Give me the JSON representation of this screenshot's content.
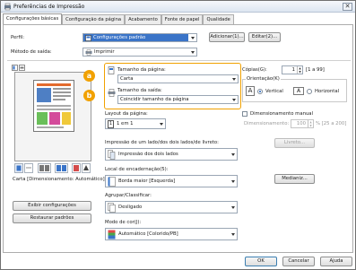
{
  "window": {
    "title": "Preferências de Impressão",
    "close_glyph": "✕"
  },
  "tabs": [
    {
      "label": "Configurações básicas"
    },
    {
      "label": "Configuração da página"
    },
    {
      "label": "Acabamento"
    },
    {
      "label": "Fonte de papel"
    },
    {
      "label": "Qualidade"
    }
  ],
  "profile": {
    "label": "Perfil:",
    "value": "Configurações padrão",
    "add_button": "Adicionar(1)...",
    "edit_button": "Editar(2)..."
  },
  "output_method": {
    "label": "Método de saída:",
    "value": "Imprimir"
  },
  "preview_caption": "Carta [Dimensionamento: Automático]",
  "callouts": {
    "a": "a",
    "b": "b"
  },
  "page_size": {
    "label": "Tamanho da página:",
    "value": "Carta"
  },
  "output_size": {
    "label": "Tamanho da saída:",
    "value": "Coincidir tamanho da página"
  },
  "copies": {
    "label": "Cópias(G):",
    "value": "1",
    "range": "[1 a 99]"
  },
  "orientation": {
    "label": "Orientação(K)",
    "portrait": "Vertical",
    "landscape": "Horizontal",
    "portrait_icon_glyph": "A",
    "landscape_icon_glyph": "A"
  },
  "layout": {
    "label": "Layout da página:",
    "value": "1 em 1",
    "icon_glyph": "1"
  },
  "manual_scaling": {
    "label": "Dimensionamento manual",
    "field_label": "Dimensionamento:",
    "value": "100",
    "range": "% [25 a 200]"
  },
  "duplex": {
    "label": "Impressão de um lado/dos dois lados/de livreto:",
    "value": "Impressão dos dois lados",
    "booklet_button": "Livreto..."
  },
  "binding": {
    "label": "Local de encadernação(5):",
    "value": "Borda maior [Esquerda]",
    "margin_button": "Medianiz..."
  },
  "collate": {
    "label": "Agrupar/Classificar:",
    "value": "Desligado"
  },
  "color_mode": {
    "label": "Modo de cor(J):",
    "value": "Automático [Colorido/PB]"
  },
  "left_buttons": {
    "view_settings": "Exibir configurações",
    "restore_defaults": "Restaurar padrões"
  },
  "footer": {
    "ok": "OK",
    "cancel": "Cancelar",
    "help": "Ajuda"
  },
  "colors": {
    "accent": "#f1a100",
    "selection": "#3a74c8"
  }
}
